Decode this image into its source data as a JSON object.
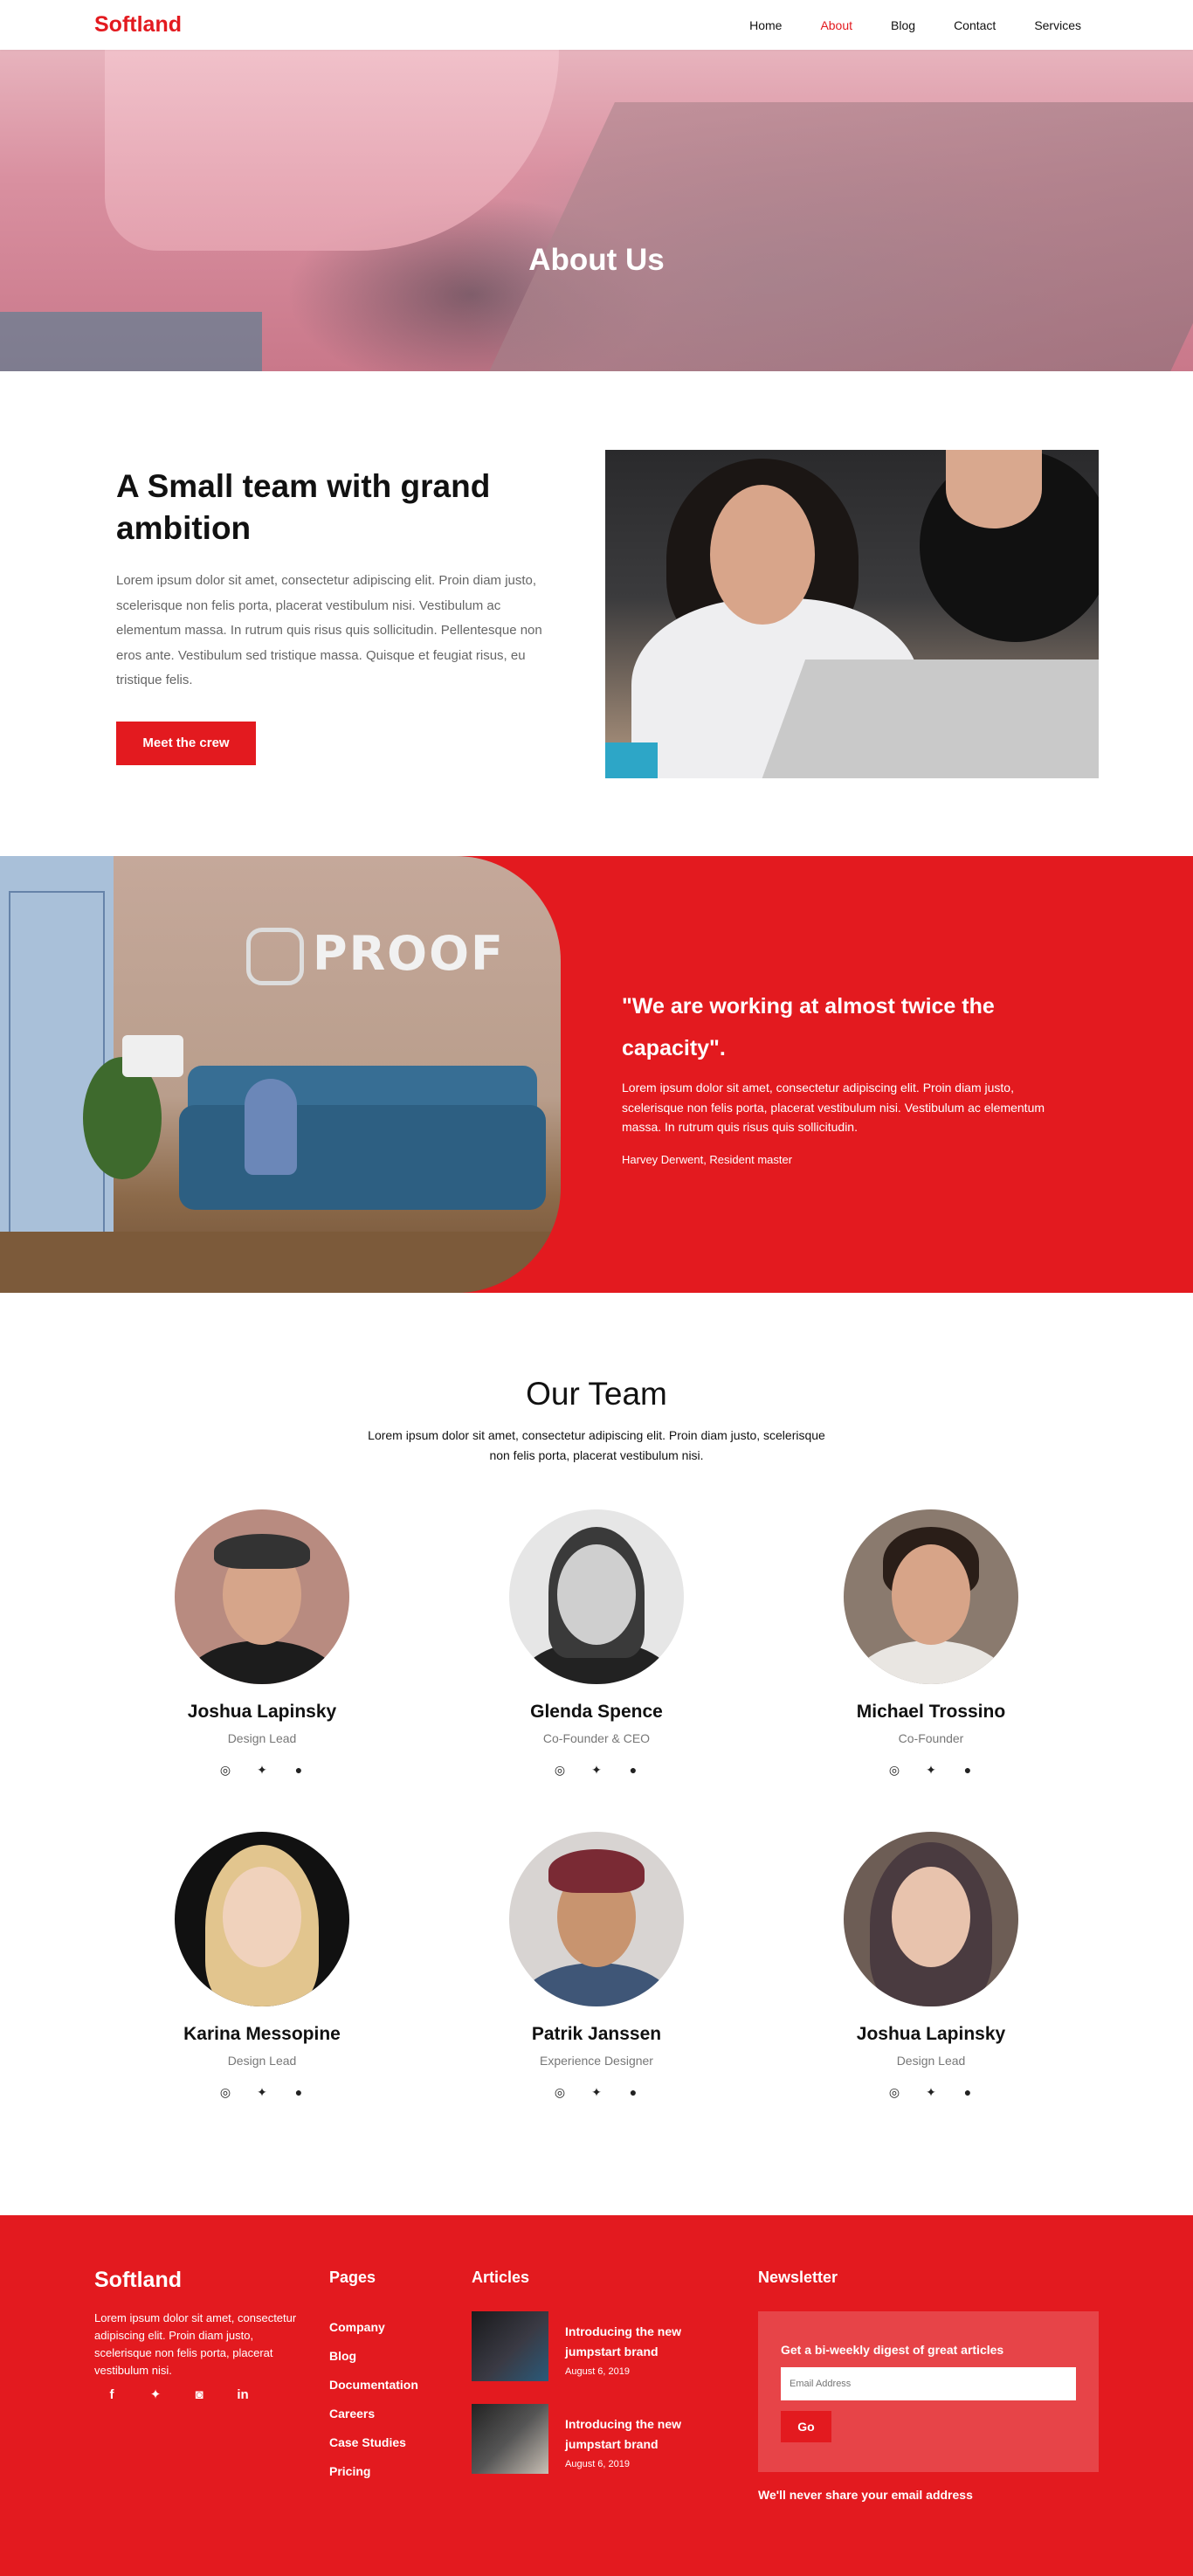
{
  "header": {
    "brand": "Softland",
    "nav": [
      "Home",
      "About",
      "Blog",
      "Contact",
      "Services"
    ]
  },
  "hero": {
    "title": "About Us"
  },
  "about": {
    "title": "A Small team with grand ambition",
    "body": "Lorem ipsum dolor sit amet, consectetur adipiscing elit. Proin diam justo, scelerisque non felis porta, placerat vestibulum nisi. Vestibulum ac elementum massa. In rutrum quis risus quis sollicitudin. Pellentesque non eros ante. Vestibulum sed tristique massa. Quisque et feugiat risus, eu tristique felis.",
    "button": "Meet the crew"
  },
  "quote": {
    "logo_text": "PROOF",
    "text": "\"We are working at almost twice the capacity\".",
    "body": "Lorem ipsum dolor sit amet, consectetur adipiscing elit. Proin diam justo, scelerisque non felis porta, placerat vestibulum nisi. Vestibulum ac elementum massa. In rutrum quis risus quis sollicitudin.",
    "author": "Harvey Derwent, Resident master"
  },
  "team": {
    "title": "Our Team",
    "lead": "Lorem ipsum dolor sit amet, consectetur adipiscing elit. Proin diam justo, scelerisque non felis porta, placerat vestibulum nisi.",
    "members": [
      {
        "name": "Joshua Lapinsky",
        "role": "Design Lead"
      },
      {
        "name": "Glenda Spence",
        "role": "Co-Founder & CEO"
      },
      {
        "name": "Michael Trossino",
        "role": "Co-Founder"
      },
      {
        "name": "Karina Messopine",
        "role": "Design Lead"
      },
      {
        "name": "Patrik Janssen",
        "role": "Experience Designer"
      },
      {
        "name": "Joshua Lapinsky",
        "role": "Design Lead"
      }
    ],
    "social_icons": [
      "dribbble-icon",
      "twitter-icon",
      "github-icon"
    ]
  },
  "footer": {
    "brand": "Softland",
    "about": "Lorem ipsum dolor sit amet, consectetur adipiscing elit. Proin diam justo, scelerisque non felis porta, placerat vestibulum nisi.",
    "social_icons": [
      "facebook-icon",
      "twitter-icon",
      "instagram-icon",
      "linkedin-icon"
    ],
    "pages_title": "Pages",
    "pages": [
      "Company",
      "Blog",
      "Documentation",
      "Careers",
      "Case Studies",
      "Pricing"
    ],
    "articles_title": "Articles",
    "articles": [
      {
        "title": "Introducing the new jumpstart brand",
        "date": "August 6, 2019"
      },
      {
        "title": "Introducing the new jumpstart brand",
        "date": "August 6, 2019"
      }
    ],
    "newsletter_title": "Newsletter",
    "newsletter_label": "Get a bi-weekly digest of great articles",
    "email_placeholder": "Email Address",
    "go_label": "Go",
    "note": "We'll never share your email address"
  },
  "colors": {
    "accent": "#e31a1f",
    "newsletter_box": "#e74448"
  }
}
